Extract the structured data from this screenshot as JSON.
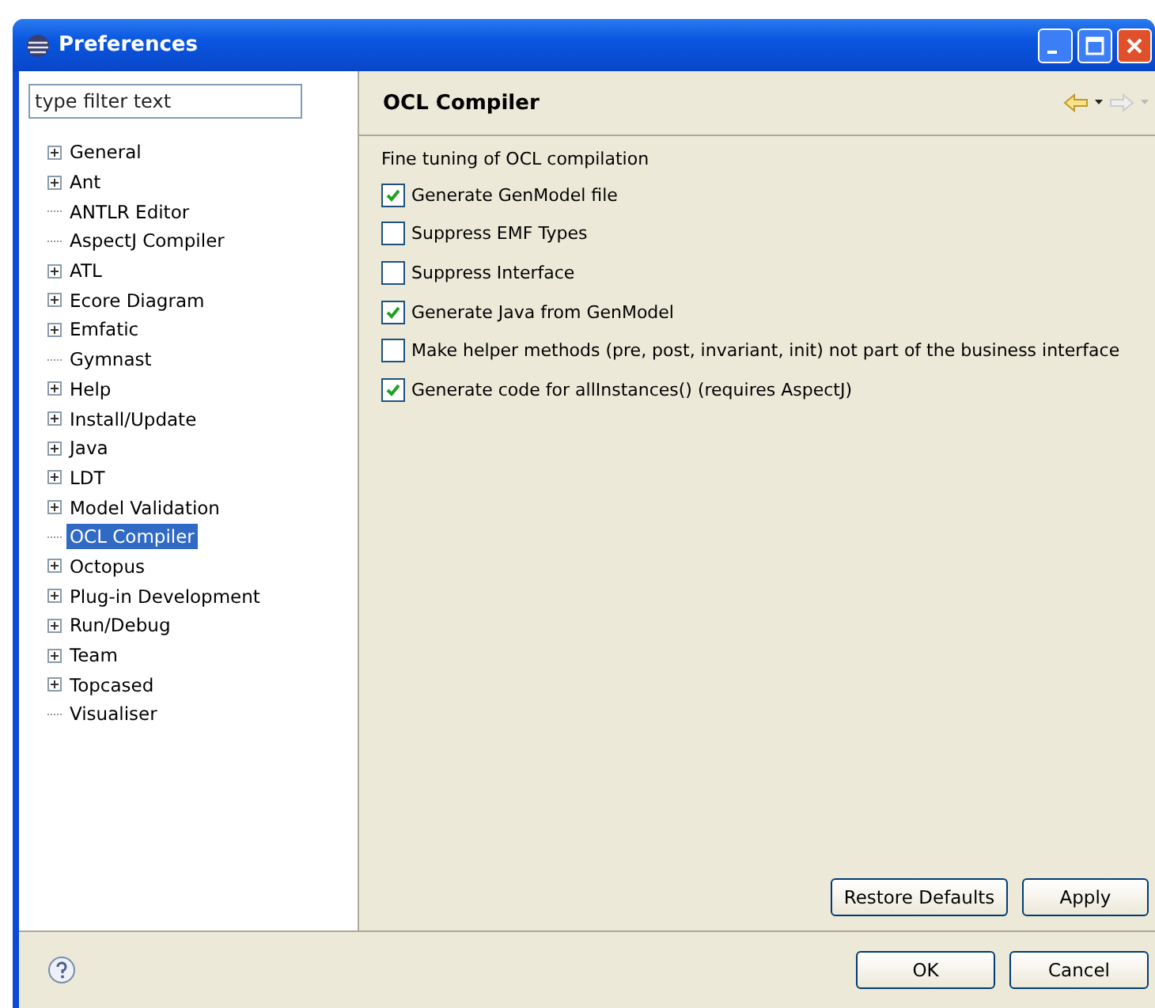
{
  "window": {
    "title": "Preferences"
  },
  "filter": {
    "placeholder": "type filter text"
  },
  "tree": [
    {
      "label": "General",
      "kind": "folder",
      "selected": false
    },
    {
      "label": "Ant",
      "kind": "folder",
      "selected": false
    },
    {
      "label": "ANTLR Editor",
      "kind": "leaf",
      "selected": false
    },
    {
      "label": "AspectJ Compiler",
      "kind": "leaf",
      "selected": false
    },
    {
      "label": "ATL",
      "kind": "folder",
      "selected": false
    },
    {
      "label": "Ecore Diagram",
      "kind": "folder",
      "selected": false
    },
    {
      "label": "Emfatic",
      "kind": "folder",
      "selected": false
    },
    {
      "label": "Gymnast",
      "kind": "leaf",
      "selected": false
    },
    {
      "label": "Help",
      "kind": "folder",
      "selected": false
    },
    {
      "label": "Install/Update",
      "kind": "folder",
      "selected": false
    },
    {
      "label": "Java",
      "kind": "folder",
      "selected": false
    },
    {
      "label": "LDT",
      "kind": "folder",
      "selected": false
    },
    {
      "label": "Model Validation",
      "kind": "folder",
      "selected": false
    },
    {
      "label": "OCL Compiler",
      "kind": "leaf",
      "selected": true
    },
    {
      "label": "Octopus",
      "kind": "folder",
      "selected": false
    },
    {
      "label": "Plug-in Development",
      "kind": "folder",
      "selected": false
    },
    {
      "label": "Run/Debug",
      "kind": "folder",
      "selected": false
    },
    {
      "label": "Team",
      "kind": "folder",
      "selected": false
    },
    {
      "label": "Topcased",
      "kind": "folder",
      "selected": false
    },
    {
      "label": "Visualiser",
      "kind": "leaf",
      "selected": false
    }
  ],
  "page": {
    "title": "OCL Compiler",
    "description": "Fine tuning of OCL compilation",
    "options": [
      {
        "label": "Generate GenModel file",
        "checked": true
      },
      {
        "label": "Suppress EMF Types",
        "checked": false
      },
      {
        "label": "Suppress Interface",
        "checked": false
      },
      {
        "label": "Generate Java from GenModel",
        "checked": true
      },
      {
        "label": "Make helper methods (pre, post, invariant, init) not part of the business interface",
        "checked": false
      },
      {
        "label": "Generate code for allInstances() (requires AspectJ)",
        "checked": true
      }
    ],
    "buttons": [
      "Restore Defaults",
      "Apply"
    ]
  },
  "footer_buttons": [
    "OK",
    "Cancel"
  ]
}
